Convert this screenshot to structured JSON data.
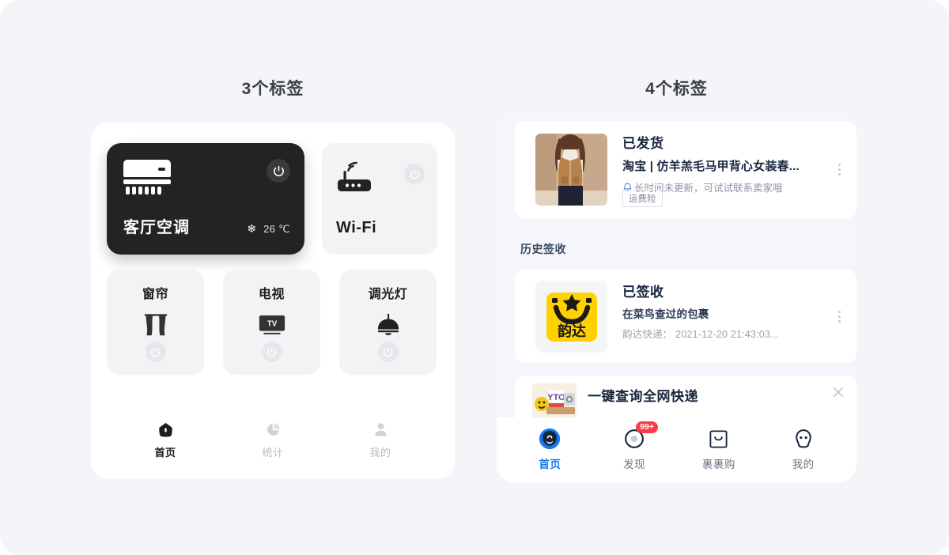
{
  "theme": {
    "page_bg": "#f4f5f9",
    "accent_blue": "#1778f2",
    "dark_card": "#232323",
    "badge_red": "#fb3b4a",
    "yunda_yellow": "#ffd100"
  },
  "left_panel": {
    "title": "3个标签",
    "ac_card": {
      "name": "客厅空调",
      "mode_icon": "snowflake-icon",
      "temperature": "26 ℃",
      "power_icon": "power-icon"
    },
    "wifi_card": {
      "name": "Wi-Fi",
      "device_icon": "router-icon",
      "power_icon": "power-icon"
    },
    "devices": [
      {
        "name": "窗帘",
        "icon": "curtain-icon",
        "power_icon": "power-icon"
      },
      {
        "name": "电视",
        "icon": "tv-icon",
        "power_icon": "power-icon"
      },
      {
        "name": "调光灯",
        "icon": "pendant-lamp-icon",
        "power_icon": "power-icon"
      }
    ],
    "tabs": [
      {
        "label": "首页",
        "icon": "home-icon",
        "active": true
      },
      {
        "label": "统计",
        "icon": "pie-chart-icon",
        "active": false
      },
      {
        "label": "我的",
        "icon": "person-icon",
        "active": false
      }
    ]
  },
  "right_panel": {
    "title": "4个标签",
    "section_label": "历史签收",
    "package_1": {
      "status": "已发货",
      "title": "淘宝 | 仿羊羔毛马甲背心女装春...",
      "note": "长时间未更新，可试试联系卖家哦",
      "note_icon": "bell-icon",
      "tag": "运费险",
      "thumb_icon": "product-photo",
      "menu_icon": "kebab-menu-icon"
    },
    "package_2": {
      "status": "已签收",
      "title": "在菜鸟查过的包裹",
      "detail": "韵达快递： 2021-12-20 21:43:03...",
      "logo_icon": "yunda-logo",
      "menu_icon": "kebab-menu-icon"
    },
    "promo": {
      "title": "一键查询全网快递",
      "logo_icon": "promo-logo",
      "close_icon": "close-icon"
    },
    "tabs": [
      {
        "label": "首页",
        "icon": "chat-home-icon",
        "active": true,
        "badge": ""
      },
      {
        "label": "发现",
        "icon": "discover-icon",
        "active": false,
        "badge": "99+"
      },
      {
        "label": "裹裹购",
        "icon": "parcel-box-icon",
        "active": false,
        "badge": ""
      },
      {
        "label": "我的",
        "icon": "profile-ghost-icon",
        "active": false,
        "badge": ""
      }
    ]
  }
}
